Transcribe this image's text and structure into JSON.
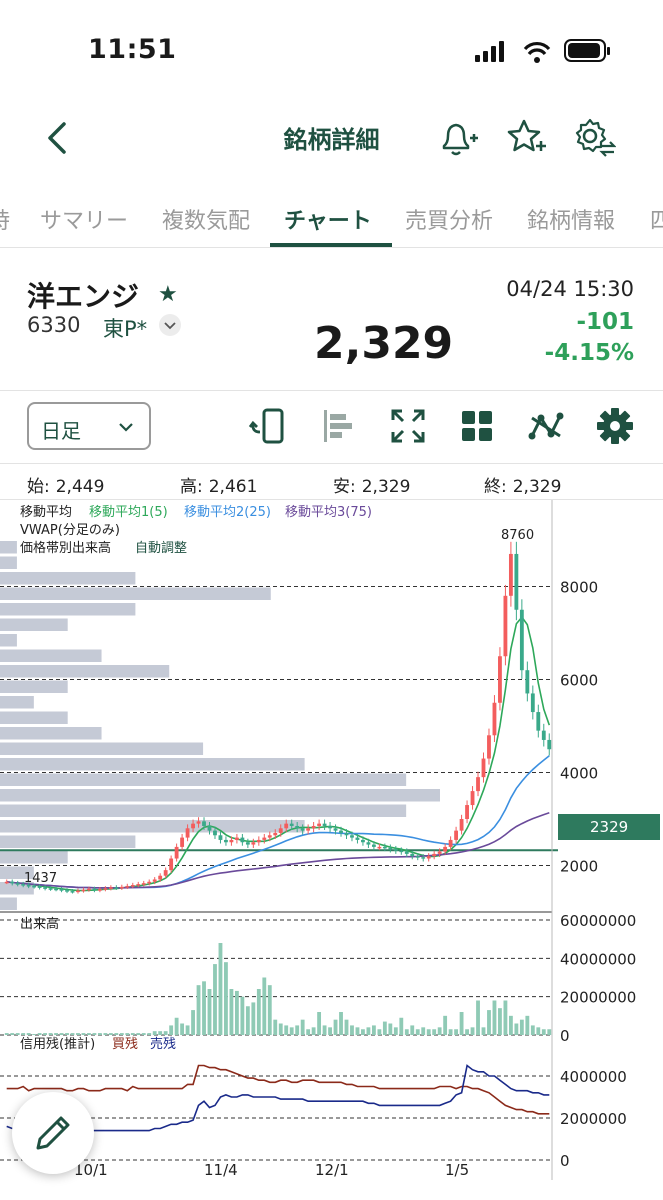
{
  "status_bar": {
    "time": "11:51"
  },
  "nav": {
    "title": "銘柄詳細"
  },
  "tabs": [
    {
      "label": "時"
    },
    {
      "label": "サマリー"
    },
    {
      "label": "複数気配"
    },
    {
      "label": "チャート"
    },
    {
      "label": "売買分析"
    },
    {
      "label": "銘柄情報"
    },
    {
      "label": "四"
    }
  ],
  "active_tab": "チャート",
  "quote": {
    "name": "洋エンジ",
    "code": "6330",
    "market": "東P*",
    "price": "2,329",
    "datetime": "04/24 15:30",
    "change": "-101",
    "change_pct": "-4.15%"
  },
  "toolbar": {
    "period": "日足"
  },
  "ohlc": {
    "open_label": "始:",
    "open": "2,449",
    "high_label": "高:",
    "high": "2,461",
    "low_label": "安:",
    "low": "2,329",
    "close_label": "終:",
    "close": "2,329"
  },
  "chart_legend": {
    "ma_label": "移動平均",
    "ma1": "移動平均1(5)",
    "ma2": "移動平均2(25)",
    "ma3": "移動平均3(75)",
    "vwap": "VWAP(分足のみ)",
    "volume_profile": "価格帯別出来高",
    "volume_profile_mode": "自動調整",
    "volume_title": "出来高",
    "margin_title": "信用残(推計)",
    "margin_buy": "買残",
    "margin_sell": "売残"
  },
  "colors": {
    "brand": "#1f5141",
    "up": "#f35d5d",
    "down": "#3aa98a",
    "ma1": "#2ea85a",
    "ma2": "#3b8fe0",
    "ma3": "#6a4a9a",
    "margin_buy": "#8b2a1a",
    "margin_sell": "#1a2a8a"
  },
  "chart_data": {
    "type": "candlestick",
    "price_axis": {
      "ticks": [
        2000,
        4000,
        6000,
        8000
      ],
      "current": 2329,
      "current_label": "2329",
      "range": [
        1000,
        9000
      ]
    },
    "annotations": {
      "max": 8760,
      "max_label": "8760",
      "min": 1437,
      "min_label": "1437"
    },
    "x_ticks": [
      "10/1",
      "11/4",
      "12/1",
      "1/5"
    ],
    "price_series": [
      1650,
      1620,
      1600,
      1580,
      1560,
      1550,
      1530,
      1510,
      1500,
      1490,
      1470,
      1450,
      1440,
      1460,
      1480,
      1500,
      1470,
      1490,
      1510,
      1530,
      1520,
      1540,
      1560,
      1580,
      1600,
      1620,
      1650,
      1700,
      1780,
      1900,
      2150,
      2400,
      2600,
      2800,
      2900,
      2950,
      2850,
      2750,
      2650,
      2550,
      2500,
      2550,
      2600,
      2500,
      2450,
      2500,
      2550,
      2600,
      2650,
      2700,
      2800,
      2900,
      2850,
      2800,
      2750,
      2800,
      2850,
      2900,
      2850,
      2800,
      2750,
      2700,
      2650,
      2600,
      2550,
      2500,
      2450,
      2400,
      2400,
      2380,
      2350,
      2320,
      2300,
      2250,
      2200,
      2180,
      2150,
      2200,
      2250,
      2300,
      2400,
      2550,
      2750,
      3000,
      3300,
      3600,
      3900,
      4300,
      4800,
      5500,
      6500,
      7800,
      8700,
      7500,
      6200,
      5700,
      5300,
      4900,
      4700,
      4500
    ],
    "volume_axis": {
      "ticks": [
        0,
        20000000,
        40000000,
        60000000
      ],
      "labels": [
        "0",
        "20000000",
        "40000000",
        "60000000"
      ]
    },
    "volume_series": [
      1,
      1,
      1,
      1,
      1,
      0.5,
      1,
      1,
      1,
      1,
      1,
      1,
      1,
      1,
      1,
      1,
      1,
      1,
      1,
      1,
      1,
      1,
      1,
      1,
      1,
      1,
      1,
      2,
      2,
      2,
      5,
      9,
      6,
      5,
      13,
      26,
      28,
      24,
      37,
      48,
      38,
      24,
      23,
      20,
      15,
      17,
      24,
      30,
      26,
      8,
      6,
      5,
      4,
      5,
      8,
      3,
      4,
      12,
      5,
      4,
      8,
      12,
      8,
      5,
      4,
      3,
      4,
      5,
      3,
      7,
      6,
      4,
      9,
      3,
      5,
      3,
      4,
      3,
      3,
      4,
      10,
      3,
      3,
      12,
      3,
      4,
      18,
      4,
      13,
      18,
      14,
      18,
      10,
      6,
      8,
      10,
      5,
      4,
      3,
      3
    ],
    "margin_axis": {
      "ticks": [
        0,
        2000000,
        4000000
      ],
      "labels": [
        "0",
        "2000000",
        "4000000"
      ]
    },
    "margin_buy_series": [
      3.4,
      3.4,
      3.4,
      3.5,
      3.3,
      3.4,
      3.4,
      3.4,
      3.4,
      3.4,
      3.4,
      3.3,
      3.3,
      3.4,
      3.4,
      3.3,
      3.3,
      3.3,
      3.4,
      3.4,
      3.4,
      3.4,
      3.3,
      3.5,
      3.4,
      3.4,
      3.4,
      3.4,
      3.4,
      3.4,
      3.4,
      3.4,
      3.4,
      3.6,
      3.6,
      4.5,
      4.5,
      4.4,
      4.4,
      4.3,
      4.3,
      4.2,
      4.1,
      4.0,
      3.9,
      3.9,
      3.8,
      3.8,
      3.7,
      3.7,
      3.8,
      3.8,
      3.7,
      3.7,
      3.8,
      3.8,
      3.8,
      3.7,
      3.7,
      3.7,
      3.7,
      3.7,
      3.6,
      3.6,
      3.5,
      3.5,
      3.5,
      3.5,
      3.4,
      3.4,
      3.4,
      3.4,
      3.4,
      3.4,
      3.4,
      3.4,
      3.4,
      3.4,
      3.4,
      3.5,
      3.5,
      3.5,
      3.4,
      3.5,
      3.5,
      3.4,
      3.4,
      3.3,
      3.2,
      3.0,
      2.8,
      2.6,
      2.5,
      2.4,
      2.4,
      2.3,
      2.3,
      2.2,
      2.2,
      2.2
    ],
    "margin_sell_series": [
      1.6,
      1.5,
      1.5,
      1.5,
      1.5,
      1.5,
      1.4,
      1.4,
      1.4,
      1.4,
      1.4,
      1.4,
      1.4,
      1.4,
      1.4,
      1.4,
      1.4,
      1.4,
      1.4,
      1.4,
      1.4,
      1.4,
      1.4,
      1.4,
      1.4,
      1.4,
      1.4,
      1.5,
      1.5,
      1.6,
      1.7,
      1.7,
      1.8,
      1.8,
      1.9,
      2.6,
      2.8,
      2.5,
      2.6,
      3.0,
      3.1,
      3.0,
      3.0,
      3.1,
      3.1,
      3.0,
      3.0,
      3.0,
      3.0,
      3.0,
      2.9,
      2.9,
      2.9,
      2.9,
      2.9,
      2.8,
      2.8,
      2.8,
      2.8,
      2.8,
      2.8,
      2.8,
      2.8,
      2.8,
      2.8,
      2.8,
      2.7,
      2.7,
      2.6,
      2.6,
      2.6,
      2.6,
      2.6,
      2.6,
      2.6,
      2.6,
      2.6,
      2.6,
      2.6,
      2.6,
      2.7,
      2.8,
      3.1,
      3.2,
      4.5,
      4.3,
      4.2,
      4.2,
      4.0,
      4.0,
      3.8,
      3.6,
      3.4,
      3.3,
      3.3,
      3.3,
      3.2,
      3.2,
      3.1,
      3.1
    ],
    "volume_profile": [
      0.5,
      0.5,
      4,
      8,
      4,
      2,
      0.5,
      3,
      5,
      2,
      1,
      2,
      3,
      6,
      9,
      12,
      13,
      12,
      9,
      4,
      2,
      1,
      1,
      0.5
    ],
    "grid": true
  }
}
